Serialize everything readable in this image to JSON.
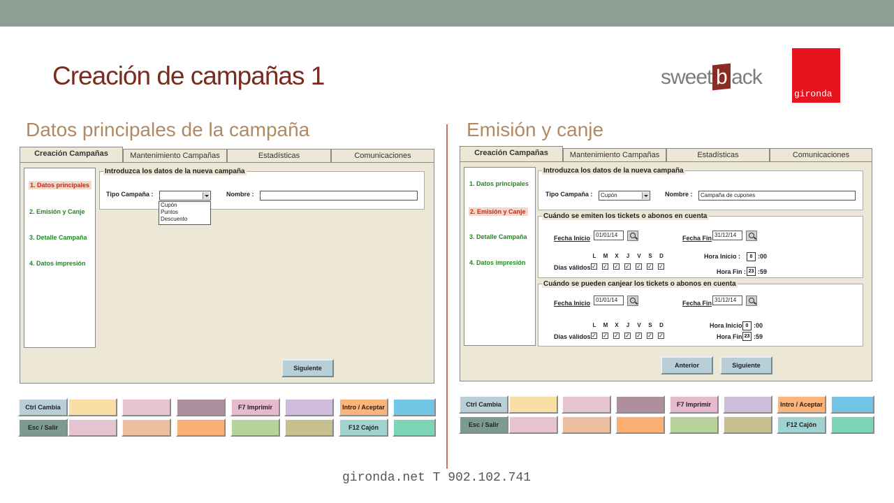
{
  "slide": {
    "title": "Creación de campañas 1",
    "footer": "gironda.net T 902.102.741",
    "logo_sweetback": {
      "pre": "sweet",
      "b": "b",
      "post": "ack"
    },
    "logo_gironda": "gironda",
    "left_heading": "Datos principales de la campaña",
    "right_heading": "Emisión y canje"
  },
  "tabs": [
    "Creación Campañas",
    "Mantenimiento Campañas",
    "Estadísticas",
    "Comunicaciones"
  ],
  "sidebar": [
    "1. Datos principales",
    "2. Emisión y Canje",
    "3. Detalle Campaña",
    "4. Datos impresión"
  ],
  "left": {
    "group_title": "Introduzca los datos de la nueva campaña",
    "tipo_label": "Tipo Campaña :",
    "tipo_value": "",
    "nombre_label": "Nombre :",
    "nombre_value": "",
    "options": [
      "Cupón",
      "Puntos",
      "Descuento"
    ],
    "next_button": "Siguiente"
  },
  "right": {
    "group_title": "Introduzca los datos de la nueva campaña",
    "tipo_label": "Tipo Campaña :",
    "tipo_value": "Cupón",
    "nombre_label": "Nombre :",
    "nombre_value": "Campaña de cupones",
    "emision": {
      "title": "Cuándo se emiten los tickets o abonos en cuenta",
      "fecha_inicio_label": "Fecha Inicio",
      "fecha_inicio": "01/01/14",
      "fecha_fin_label": "Fecha Fin",
      "fecha_fin": "31/12/14",
      "dias_label": "Días válidos :",
      "hora_inicio_label": "Hora Inicio :",
      "hora_inicio": "0",
      "hora_inicio_min": ":00",
      "hora_fin_label": "Hora Fin :",
      "hora_fin": "23",
      "hora_fin_min": ":59"
    },
    "canje": {
      "title": "Cuándo se pueden canjear los tickets o abonos en cuenta",
      "fecha_inicio_label": "Fecha Inicio",
      "fecha_inicio": "01/01/14",
      "fecha_fin_label": "Fecha Fin",
      "fecha_fin": "31/12/14",
      "dias_label": "Días válidos :",
      "hora_inicio_label": "Hora Inicio :",
      "hora_inicio": "0",
      "hora_inicio_min": ":00",
      "hora_fin_label": "Hora Fin :",
      "hora_fin": "23",
      "hora_fin_min": ":59"
    },
    "days": [
      "L",
      "M",
      "X",
      "J",
      "V",
      "S",
      "D"
    ],
    "check_mark": "✓",
    "prev_button": "Anterior",
    "next_button": "Siguiente"
  },
  "keys": {
    "row1": [
      {
        "label": "Ctrl Cambia",
        "color": "#b9cfd8"
      },
      {
        "label": "",
        "color": "#f9dea5"
      },
      {
        "label": "",
        "color": "#e6c3d1"
      },
      {
        "label": "",
        "color": "#ad8f9e"
      },
      {
        "label": "F7 Imprimir",
        "color": "#e6b9cc"
      },
      {
        "label": "",
        "color": "#cfbcdc"
      },
      {
        "label": "Intro / Aceptar",
        "color": "#fbb47a"
      },
      {
        "label": "",
        "color": "#73c5e6"
      }
    ],
    "row2": [
      {
        "label": "Esc / Salir",
        "color": "#7c9a8f"
      },
      {
        "label": "",
        "color": "#e6c3d1"
      },
      {
        "label": "",
        "color": "#ebbf9f"
      },
      {
        "label": "",
        "color": "#fbb073"
      },
      {
        "label": "",
        "color": "#b6d39c"
      },
      {
        "label": "",
        "color": "#c6bf8e"
      },
      {
        "label": "F12 Cajón",
        "color": "#9fd3cf"
      },
      {
        "label": "",
        "color": "#7ed4b6"
      }
    ]
  }
}
